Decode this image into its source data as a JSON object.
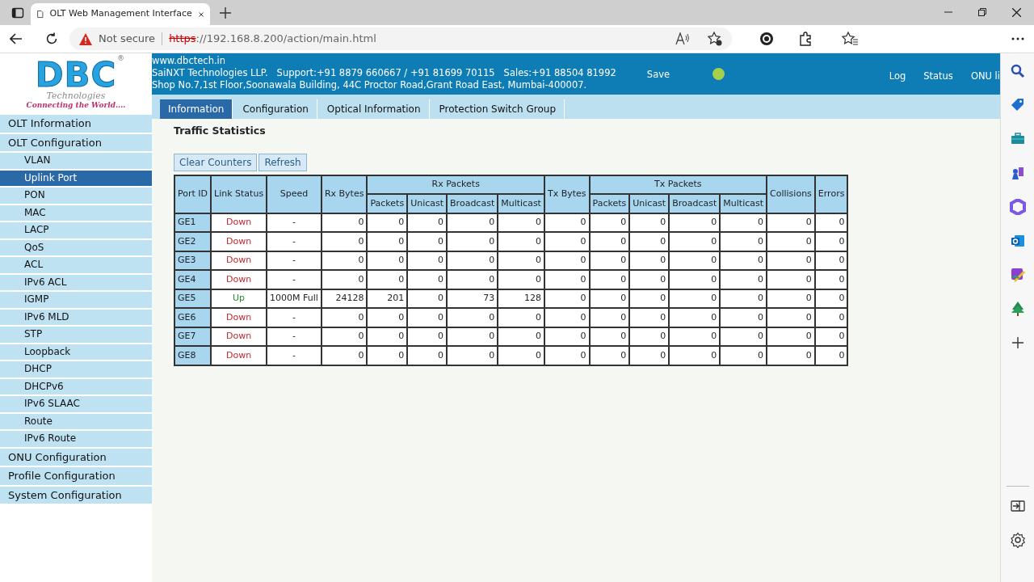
{
  "browser": {
    "tab_title": "OLT Web Management Interface",
    "address": {
      "warning": "Not secure",
      "scheme": "https",
      "rest": "://192.168.8.200/action/main.html"
    }
  },
  "logo": {
    "name": "DBC",
    "mark": "®",
    "sub": "Technologies",
    "tagline": "Connecting the World...."
  },
  "header": {
    "lines": [
      "www.dbctech.in",
      "SaiNXT Technologies LLP.   Support:+91 8879 660667 / +91 81699 70115   Sales:+91 88504 81992",
      "Shop No.7,1st Floor,Soonawala Building, 44C Proctor Road,Grant Road East, Mumbai-400007."
    ],
    "save": "Save",
    "links": [
      "Log",
      "Status",
      "ONU li"
    ]
  },
  "tabs": [
    {
      "label": "Information",
      "selected": true
    },
    {
      "label": "Configuration",
      "selected": false
    },
    {
      "label": "Optical Information",
      "selected": false
    },
    {
      "label": "Protection Switch Group",
      "selected": false
    }
  ],
  "sidebar": {
    "items": [
      {
        "label": "OLT Information",
        "selected": false
      },
      {
        "label": "OLT Configuration",
        "selected": false,
        "children": [
          {
            "label": "VLAN",
            "selected": false
          },
          {
            "label": "Uplink Port",
            "selected": true
          },
          {
            "label": "PON",
            "selected": false
          },
          {
            "label": "MAC",
            "selected": false
          },
          {
            "label": "LACP",
            "selected": false
          },
          {
            "label": "QoS",
            "selected": false
          },
          {
            "label": "ACL",
            "selected": false
          },
          {
            "label": "IPv6 ACL",
            "selected": false
          },
          {
            "label": "IGMP",
            "selected": false
          },
          {
            "label": "IPv6 MLD",
            "selected": false
          },
          {
            "label": "STP",
            "selected": false
          },
          {
            "label": "Loopback",
            "selected": false
          },
          {
            "label": "DHCP",
            "selected": false
          },
          {
            "label": "DHCPv6",
            "selected": false
          },
          {
            "label": "IPv6 SLAAC",
            "selected": false
          },
          {
            "label": "Route",
            "selected": false
          },
          {
            "label": "IPv6 Route",
            "selected": false
          }
        ]
      },
      {
        "label": "ONU Configuration",
        "selected": false
      },
      {
        "label": "Profile Configuration",
        "selected": false
      },
      {
        "label": "System Configuration",
        "selected": false
      }
    ]
  },
  "section_title": "Traffic Statistics",
  "buttons": [
    "Clear Counters",
    "Refresh"
  ],
  "table": {
    "columns": [
      {
        "label": "Port ID"
      },
      {
        "label": "Link Status"
      },
      {
        "label": "Speed"
      },
      {
        "label": "Rx Bytes"
      },
      {
        "label": "Rx Packets",
        "children": [
          "Packets",
          "Unicast",
          "Broadcast",
          "Multicast"
        ]
      },
      {
        "label": "Tx Bytes"
      },
      {
        "label": "Tx Packets",
        "children": [
          "Packets",
          "Unicast",
          "Broadcast",
          "Multicast"
        ]
      },
      {
        "label": "Collisions"
      },
      {
        "label": "Errors"
      }
    ],
    "rows": [
      {
        "port": "GE1",
        "link": "Down",
        "up": false,
        "speed": "-",
        "values": [
          "0",
          "0",
          "0",
          "0",
          "0",
          "0",
          "0",
          "0",
          "0",
          "0",
          "0",
          "0"
        ]
      },
      {
        "port": "GE2",
        "link": "Down",
        "up": false,
        "speed": "-",
        "values": [
          "0",
          "0",
          "0",
          "0",
          "0",
          "0",
          "0",
          "0",
          "0",
          "0",
          "0",
          "0"
        ]
      },
      {
        "port": "GE3",
        "link": "Down",
        "up": false,
        "speed": "-",
        "values": [
          "0",
          "0",
          "0",
          "0",
          "0",
          "0",
          "0",
          "0",
          "0",
          "0",
          "0",
          "0"
        ]
      },
      {
        "port": "GE4",
        "link": "Down",
        "up": false,
        "speed": "-",
        "values": [
          "0",
          "0",
          "0",
          "0",
          "0",
          "0",
          "0",
          "0",
          "0",
          "0",
          "0",
          "0"
        ]
      },
      {
        "port": "GE5",
        "link": "Up",
        "up": true,
        "speed": "1000M Full",
        "values": [
          "24128",
          "201",
          "0",
          "73",
          "128",
          "0",
          "0",
          "0",
          "0",
          "0",
          "0",
          "0"
        ]
      },
      {
        "port": "GE6",
        "link": "Down",
        "up": false,
        "speed": "-",
        "values": [
          "0",
          "0",
          "0",
          "0",
          "0",
          "0",
          "0",
          "0",
          "0",
          "0",
          "0",
          "0"
        ]
      },
      {
        "port": "GE7",
        "link": "Down",
        "up": false,
        "speed": "-",
        "values": [
          "0",
          "0",
          "0",
          "0",
          "0",
          "0",
          "0",
          "0",
          "0",
          "0",
          "0",
          "0"
        ]
      },
      {
        "port": "GE8",
        "link": "Down",
        "up": false,
        "speed": "-",
        "values": [
          "0",
          "0",
          "0",
          "0",
          "0",
          "0",
          "0",
          "0",
          "0",
          "0",
          "0",
          "0"
        ]
      }
    ]
  }
}
